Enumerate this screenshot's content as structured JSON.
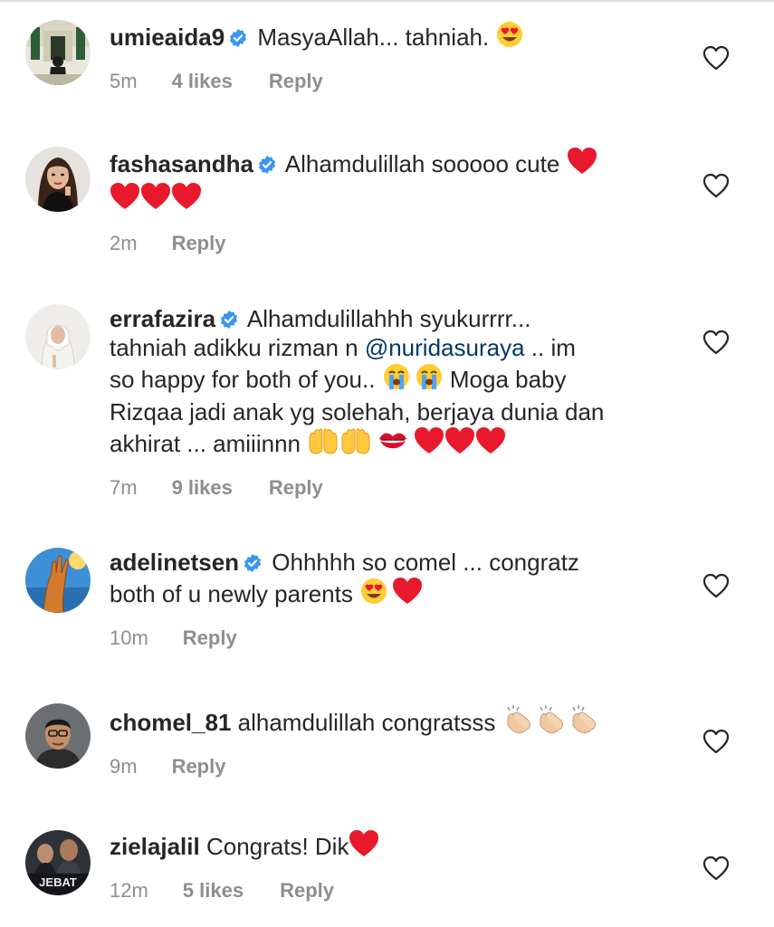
{
  "colors": {
    "text": "#262626",
    "meta": "#8e8e8e",
    "mention": "#00376b",
    "verified": "#3897f0",
    "heart_emoji": "#e8192c"
  },
  "comments": [
    {
      "username": "umieaida9",
      "verified": true,
      "segments": [
        {
          "text": " MasyaAllah... tahniah. "
        }
      ],
      "emoji_tail": [
        "heart-eyes"
      ],
      "time": "5m",
      "likes": "4 likes",
      "reply": "Reply"
    },
    {
      "username": "fashasandha",
      "verified": true,
      "text1": " Alhamdulillah sooooo cute ",
      "emoji_tail": [
        "red-heart",
        "red-heart",
        "red-heart",
        "red-heart"
      ],
      "time": "2m",
      "reply": "Reply"
    },
    {
      "username": "errafazira",
      "verified": true,
      "text1": " Alhamdulillahhh syukurrrr...",
      "text2": "tahniah  adikku rizman n ",
      "mention": "@nuridasuraya",
      "text3": " .. im",
      "text4": "so happy for both of you.. ",
      "text5": " Moga baby",
      "text6": "Rizqaa jadi anak yg solehah, berjaya dunia dan",
      "text7": "akhirat ... amiiinnn ",
      "time": "7m",
      "likes": "9 likes",
      "reply": "Reply"
    },
    {
      "username": "adelinetsen",
      "verified": true,
      "text1": " Ohhhhh so comel ... congratz",
      "text2": "both of u newly parents ",
      "time": "10m",
      "reply": "Reply"
    },
    {
      "username": "chomel_81",
      "verified": false,
      "text1": " alhamdulillah congratsss ",
      "time": "9m",
      "reply": "Reply"
    },
    {
      "username": "zielajalil",
      "verified": false,
      "text1": " Congrats! Dik",
      "time": "12m",
      "likes": "5 likes",
      "reply": "Reply",
      "avatar_text": "JEBAT"
    }
  ]
}
